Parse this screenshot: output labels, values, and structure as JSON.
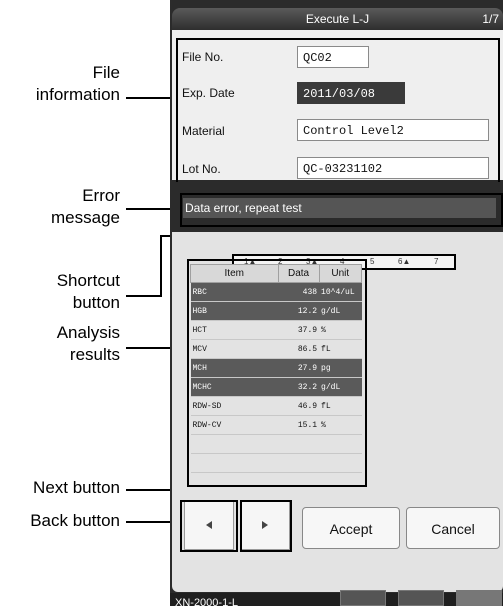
{
  "titlebar": {
    "title": "Execute L-J",
    "page": "1/7"
  },
  "annotations": {
    "file_information": [
      "File",
      "information"
    ],
    "error_message": [
      "Error",
      "message"
    ],
    "shortcut_button": [
      "Shortcut",
      "button"
    ],
    "analysis_results": [
      "Analysis",
      "results"
    ],
    "next_button": "Next button",
    "back_button": "Back button"
  },
  "file_info": {
    "file_no_label": "File No.",
    "file_no_value": "QC02",
    "exp_date_label": "Exp. Date",
    "exp_date_value": "2011/03/08",
    "material_label": "Material",
    "material_value": "Control Level2",
    "lot_no_label": "Lot No.",
    "lot_no_value": "QC-03231102"
  },
  "error": {
    "message": "Data error, repeat test"
  },
  "shortcuts": [
    "1▲",
    "2",
    "3▲",
    "4",
    "5",
    "6▲",
    "7"
  ],
  "results": {
    "headers": [
      "Item",
      "Data",
      "Unit"
    ],
    "rows": [
      {
        "item": "RBC",
        "data": "438",
        "unit": "10^4/uL",
        "error": true
      },
      {
        "item": "HGB",
        "data": "12.2",
        "unit": "g/dL",
        "error": true
      },
      {
        "item": "HCT",
        "data": "37.9",
        "unit": "%",
        "error": false
      },
      {
        "item": "MCV",
        "data": "86.5",
        "unit": "fL",
        "error": false
      },
      {
        "item": "MCH",
        "data": "27.9",
        "unit": "pg",
        "error": true
      },
      {
        "item": "MCHC",
        "data": "32.2",
        "unit": "g/dL",
        "error": true
      },
      {
        "item": "RDW-SD",
        "data": "46.9",
        "unit": "fL",
        "error": false
      },
      {
        "item": "RDW-CV",
        "data": "15.1",
        "unit": "%",
        "error": false
      },
      {
        "item": "",
        "data": "",
        "unit": "",
        "error": false
      },
      {
        "item": "",
        "data": "",
        "unit": "",
        "error": false
      }
    ]
  },
  "buttons": {
    "back_icon": "triangle-left-icon",
    "next_icon": "triangle-right-icon",
    "accept": "Accept",
    "cancel": "Cancel"
  },
  "status": {
    "model": "XN-2000-1-L"
  }
}
